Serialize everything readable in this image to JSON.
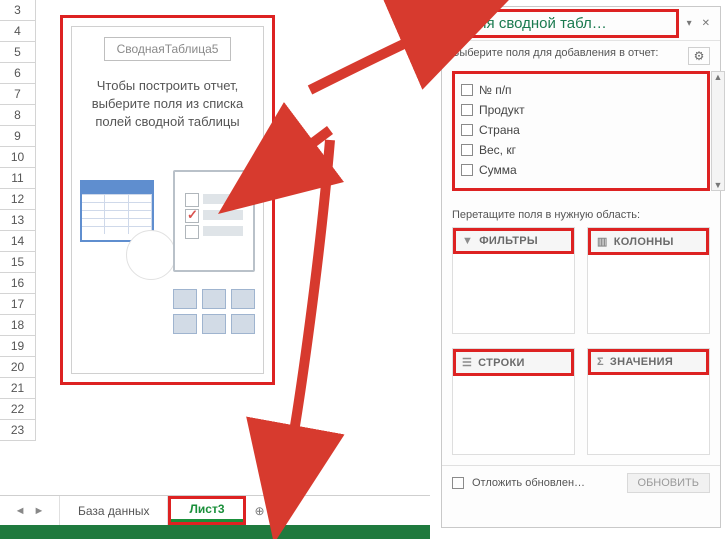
{
  "rows": [
    "3",
    "4",
    "5",
    "6",
    "7",
    "8",
    "9",
    "10",
    "11",
    "12",
    "13",
    "14",
    "15",
    "16",
    "17",
    "18",
    "19",
    "20",
    "21",
    "22",
    "23"
  ],
  "pivot_placeholder": {
    "name": "СводнаяТаблица5",
    "message_l1": "Чтобы построить отчет,",
    "message_l2": "выберите поля из списка",
    "message_l3": "полей сводной таблицы"
  },
  "tabs": {
    "data_tab": "База данных",
    "active_tab": "Лист3"
  },
  "pane": {
    "title": "Поля сводной табл…",
    "choose_label": "Выберите поля для добавления в отчет:",
    "fields": [
      "№ п/п",
      "Продукт",
      "Страна",
      "Вес, кг",
      "Сумма"
    ],
    "drag_label": "Перетащите поля в нужную область:",
    "zones": {
      "filters": "ФИЛЬТРЫ",
      "columns": "КОЛОННЫ",
      "rows": "СТРОКИ",
      "values": "ЗНАЧЕНИЯ"
    },
    "defer_label": "Отложить обновлен…",
    "update_btn": "ОБНОВИТЬ"
  },
  "icons": {
    "gear": "⚙",
    "dropdown": "▾",
    "close": "✕",
    "filter": "▼",
    "columns": "▥",
    "rows": "☰",
    "values": "Σ",
    "nav_prev": "◄",
    "nav_next": "►",
    "plus": "⊕",
    "scroll_up": "▲",
    "scroll_down": "▼"
  }
}
